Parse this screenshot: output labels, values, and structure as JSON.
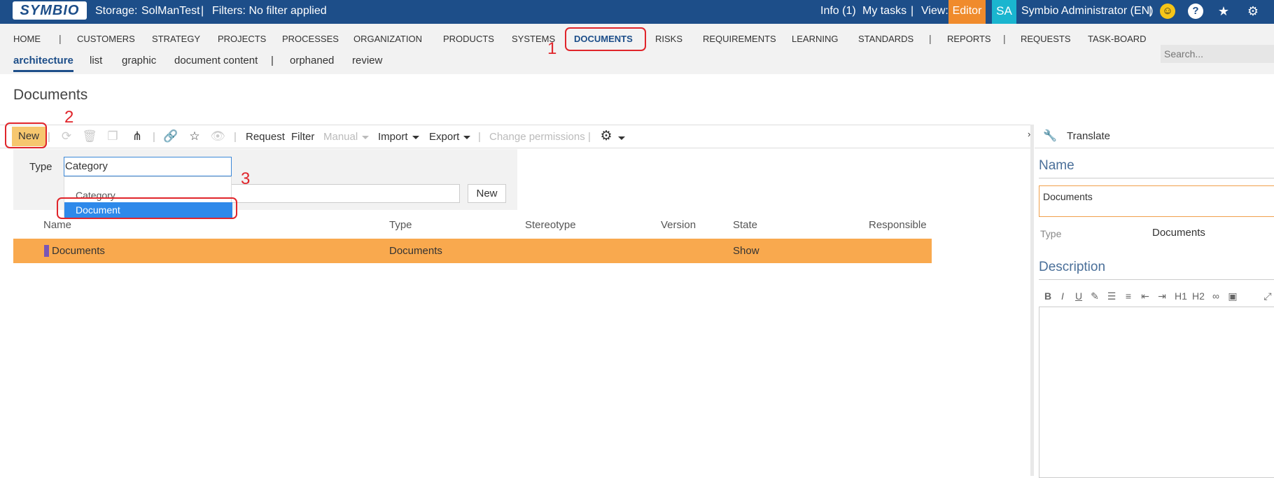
{
  "topbar": {
    "logo": "SYMBIO",
    "storage_label": "Storage:",
    "storage_value": "SolManTest",
    "separator": "|",
    "filters": "Filters: No filter applied",
    "info": "Info (1)",
    "my_tasks": "My tasks",
    "view_label": "View:",
    "view_value": "Editor",
    "avatar": "SA",
    "user": "Symbio Administrator (EN)"
  },
  "nav": {
    "items": [
      {
        "label": "HOME"
      },
      {
        "label": "CUSTOMERS"
      },
      {
        "label": "STRATEGY"
      },
      {
        "label": "PROJECTS"
      },
      {
        "label": "PROCESSES"
      },
      {
        "label": "ORGANIZATION"
      },
      {
        "label": "PRODUCTS"
      },
      {
        "label": "SYSTEMS"
      },
      {
        "label": "DOCUMENTS"
      },
      {
        "label": "RISKS"
      },
      {
        "label": "REQUIREMENTS"
      },
      {
        "label": "LEARNING"
      },
      {
        "label": "STANDARDS"
      },
      {
        "label": "REPORTS"
      },
      {
        "label": "REQUESTS"
      },
      {
        "label": "TASK-BOARD"
      }
    ],
    "separator": "|",
    "subitems": [
      {
        "label": "architecture"
      },
      {
        "label": "list"
      },
      {
        "label": "graphic"
      },
      {
        "label": "document content"
      },
      {
        "label": "orphaned"
      },
      {
        "label": "review"
      }
    ],
    "search_placeholder": "Search..."
  },
  "page_title": "Documents",
  "toolbar": {
    "new": "New",
    "request": "Request",
    "filter": "Filter",
    "manual": "Manual",
    "import": "Import",
    "export": "Export",
    "change_permissions": "Change permissions"
  },
  "new_form": {
    "type_label": "Type",
    "type_value": "Category",
    "options": [
      "Category",
      "Document"
    ],
    "new_button": "New"
  },
  "table": {
    "headers": [
      "Name",
      "Type",
      "Stereotype",
      "Version",
      "State",
      "Responsible"
    ],
    "rows": [
      {
        "name": "Documents",
        "type": "Documents",
        "stereotype": "",
        "version": "",
        "state": "Show",
        "responsible": ""
      }
    ]
  },
  "right_panel": {
    "translate": "Translate",
    "name_heading": "Name",
    "name_value": "Documents",
    "type_label": "Type",
    "type_value": "Documents",
    "description_heading": "Description",
    "editor_buttons": [
      "B",
      "I",
      "U",
      "H1",
      "H2"
    ]
  },
  "annotations": [
    "1",
    "2",
    "3"
  ],
  "colors": {
    "topbar": "#1d4e89",
    "editor_badge": "#f08b2c",
    "avatar": "#1ab5cf",
    "selected_row": "#f9a94e",
    "highlight_option": "#2e89ea",
    "annotation": "#e0252b"
  }
}
